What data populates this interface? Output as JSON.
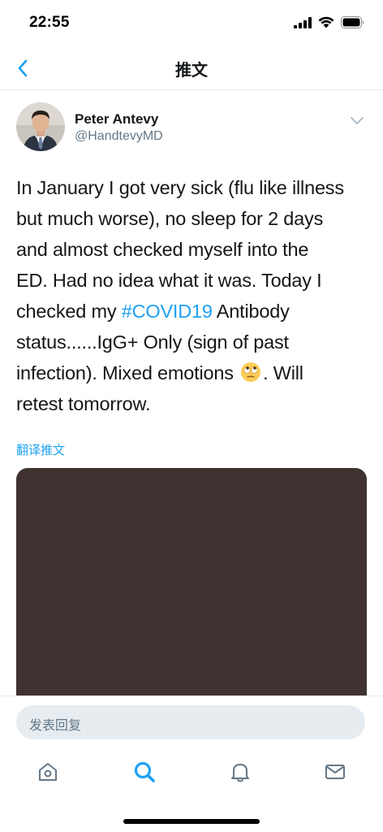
{
  "status_bar": {
    "time": "22:55"
  },
  "nav": {
    "title": "推文",
    "back_icon": "chevron-left-icon"
  },
  "tweet": {
    "author_name": "Peter Antevy",
    "author_handle": "@HandtevyMD",
    "text_lines": [
      "In January I got very sick (flu like illness",
      "but much worse), no sleep for 2 days",
      "and almost checked myself into the",
      "ED.  Had no idea what it was.  Today I",
      "checked my ",
      "status......IgG+ Only (sign of past",
      "infection).  Mixed emotions ",
      "retest tomorrow."
    ],
    "hashtag": "#COVID19",
    "after_hashtag": " Antibody",
    "after_emoji": ".  Will",
    "emoji": "face-with-rolling-eyes",
    "translate_label": "翻译推文",
    "media_color": "#3f3230"
  },
  "composer": {
    "placeholder": "发表回复"
  },
  "tab_bar": {
    "items": [
      "home-icon",
      "search-icon",
      "notifications-icon",
      "messages-icon"
    ],
    "active": "search-icon"
  },
  "colors": {
    "accent": "#1da1f2",
    "text": "#14171a",
    "secondary": "#657786",
    "divider": "#e6ecf0"
  }
}
